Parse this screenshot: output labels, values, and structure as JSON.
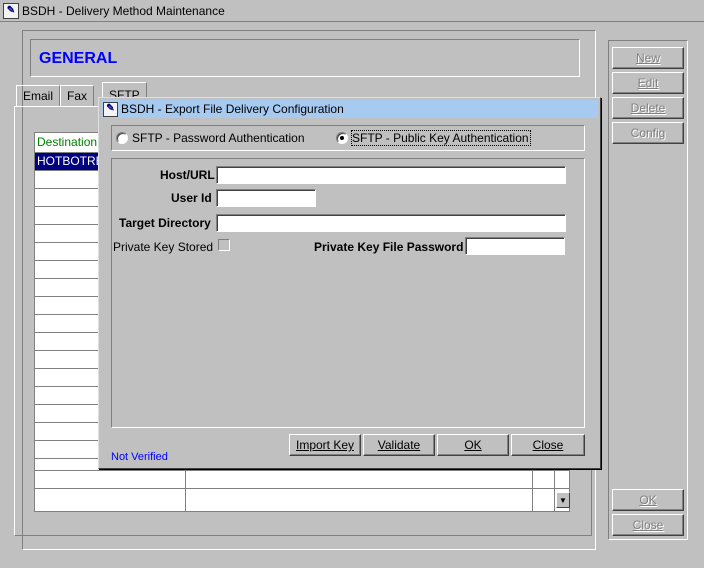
{
  "window": {
    "title": "BSDH - Delivery Method Maintenance",
    "icon": "app-icon"
  },
  "general": {
    "title": "GENERAL"
  },
  "tabs": [
    {
      "label": "Email"
    },
    {
      "label": "Fax"
    },
    {
      "label": "SFTP"
    }
  ],
  "grid": {
    "header": "Destination",
    "rows": [
      {
        "destination": "HOTBOTREL"
      }
    ]
  },
  "right_buttons": {
    "new": "New",
    "edit": "Edit",
    "delete": "Delete",
    "config": "Config",
    "ok": "OK",
    "close": "Close"
  },
  "dialog": {
    "title": "BSDH - Export File Delivery Configuration",
    "auth": {
      "password_label": "SFTP - Password Authentication",
      "publickey_label": "SFTP - Public Key Authentication",
      "selected": "public_key"
    },
    "fields": {
      "host_label": "Host/URL",
      "host_value": "",
      "userid_label": "User Id",
      "userid_value": "",
      "target_label": "Target Directory",
      "target_value": "",
      "private_key_stored_label": "Private Key Stored",
      "private_key_password_label": "Private Key File Password",
      "private_key_password_value": ""
    },
    "status": "Not Verified",
    "buttons": {
      "import_key": "Import Key",
      "validate": "Validate",
      "ok": "OK",
      "close": "Close"
    }
  }
}
